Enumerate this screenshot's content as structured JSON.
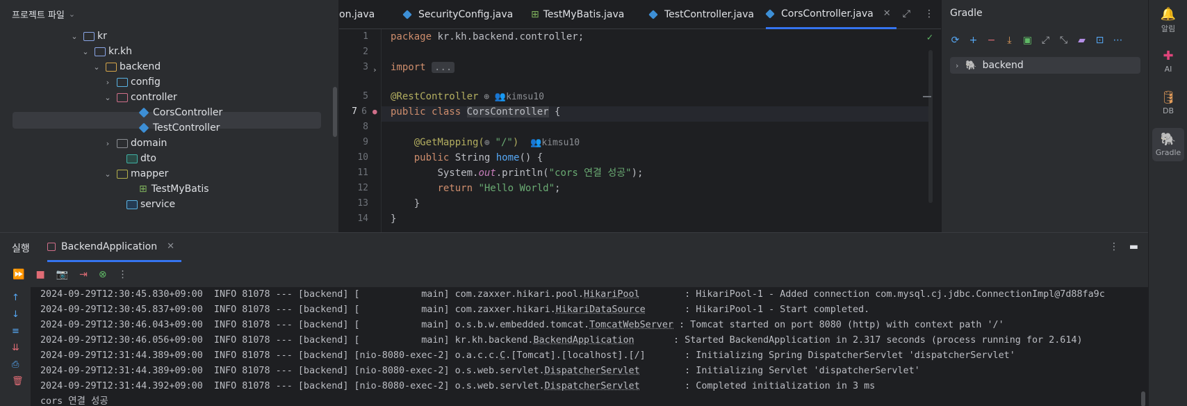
{
  "project": {
    "header": "프로젝트 파일",
    "tree": [
      {
        "label": "kr",
        "expanded": true
      },
      {
        "label": "kr.kh",
        "expanded": true
      },
      {
        "label": "backend",
        "expanded": true
      },
      {
        "label": "config",
        "expanded": false
      },
      {
        "label": "controller",
        "expanded": true
      },
      {
        "label": "CorsController",
        "selected": true
      },
      {
        "label": "TestController"
      },
      {
        "label": "domain",
        "expanded": false
      },
      {
        "label": "dto"
      },
      {
        "label": "mapper",
        "expanded": true
      },
      {
        "label": "TestMyBatis"
      },
      {
        "label": "service"
      }
    ]
  },
  "tabs": [
    {
      "label": "on.java"
    },
    {
      "label": "SecurityConfig.java"
    },
    {
      "label": "TestMyBatis.java"
    },
    {
      "label": "TestController.java"
    },
    {
      "label": "CorsController.java",
      "active": true
    }
  ],
  "editor": {
    "line_numbers": [
      "1",
      "2",
      "3",
      "5",
      "6",
      "7",
      "8",
      "9",
      "10",
      "11",
      "12",
      "13",
      "14"
    ],
    "code": {
      "l1_kw": "package",
      "l1_rest": " kr.kh.backend.controller;",
      "l3_kw": "import",
      "l3_dots": "...",
      "l6_ann": "@RestController",
      "l6_hint": "kimsu10",
      "l7_kw1": "public",
      "l7_kw2": "class",
      "l7_name": "CorsController",
      "l7_brace": " {",
      "l9_ann": "@GetMapping(",
      "l9_str": "\"/\"",
      "l9_close": ")",
      "l9_hint": "kimsu10",
      "l10_kw": "public",
      "l10_type": " String ",
      "l10_fn": "home",
      "l10_rest": "() {",
      "l11_a": "System.",
      "l11_out": "out",
      "l11_b": ".println(",
      "l11_str": "\"cors 연결 성공\"",
      "l11_c": ");",
      "l12_kw": "return",
      "l12_str": "\"Hello World\"",
      "l12_end": ";",
      "l13": "}",
      "l14": "}"
    }
  },
  "gradle": {
    "title": "Gradle",
    "root": "backend"
  },
  "strip": {
    "notifications": "알림",
    "ai": "AI",
    "db": "DB",
    "gradle": "Gradle"
  },
  "run": {
    "label": "실행",
    "tab": "BackendApplication",
    "log": [
      {
        "pre": "2024-09-29T12:30:45.830+09:00  INFO 81078 --- [backend] [           main] com.zaxxer.hikari.pool.",
        "u": "HikariPool",
        "post": "        : HikariPool-1 - Added connection com.mysql.cj.jdbc.ConnectionImpl@7d88fa9c"
      },
      {
        "pre": "2024-09-29T12:30:45.837+09:00  INFO 81078 --- [backend] [           main] com.zaxxer.hikari.",
        "u": "HikariDataSource",
        "post": "       : HikariPool-1 - Start completed."
      },
      {
        "pre": "2024-09-29T12:30:46.043+09:00  INFO 81078 --- [backend] [           main] o.s.b.w.embedded.tomcat.",
        "u": "TomcatWebServer",
        "post": " : Tomcat started on port 8080 (http) with context path '/'"
      },
      {
        "pre": "2024-09-29T12:30:46.056+09:00  INFO 81078 --- [backend] [           main] kr.kh.backend.",
        "u": "BackendApplication",
        "post": "       : Started BackendApplication in 2.317 seconds (process running for 2.614)"
      },
      {
        "pre": "2024-09-29T12:31:44.389+09:00  INFO 81078 --- [backend] [nio-8080-exec-2] o.a.c.c.",
        "u": "C",
        "post": ".[Tomcat].[localhost].[/]       : Initializing Spring DispatcherServlet 'dispatcherServlet'"
      },
      {
        "pre": "2024-09-29T12:31:44.389+09:00  INFO 81078 --- [backend] [nio-8080-exec-2] o.s.web.servlet.",
        "u": "DispatcherServlet",
        "post": "        : Initializing Servlet 'dispatcherServlet'"
      },
      {
        "pre": "2024-09-29T12:31:44.392+09:00  INFO 81078 --- [backend] [nio-8080-exec-2] o.s.web.servlet.",
        "u": "DispatcherServlet",
        "post": "        : Completed initialization in 3 ms"
      },
      {
        "pre": "cors 연결 성공",
        "u": "",
        "post": ""
      }
    ]
  },
  "colors": {
    "accent": "#3574f0",
    "keyword": "#cf8e6d",
    "annotation": "#b3ae60",
    "string": "#6aab73",
    "function": "#56a8f5"
  }
}
